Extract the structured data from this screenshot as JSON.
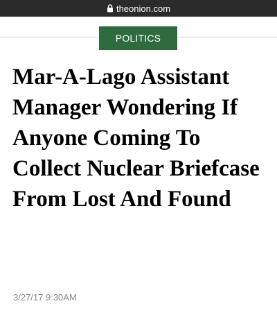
{
  "browser": {
    "url": "theonion.com",
    "lock_icon": "lock-icon"
  },
  "article": {
    "section": "POLITICS",
    "headline": "Mar-A-Lago Assistant Manager Wondering If Anyone Coming To Collect Nuclear Briefcase From Lost And Found",
    "timestamp": "3/27/17 9:30AM"
  },
  "colors": {
    "url_bar_bg": "#2b2b2b",
    "section_tag_bg": "#2e6b3d",
    "timestamp_text": "#8a8a8a"
  }
}
